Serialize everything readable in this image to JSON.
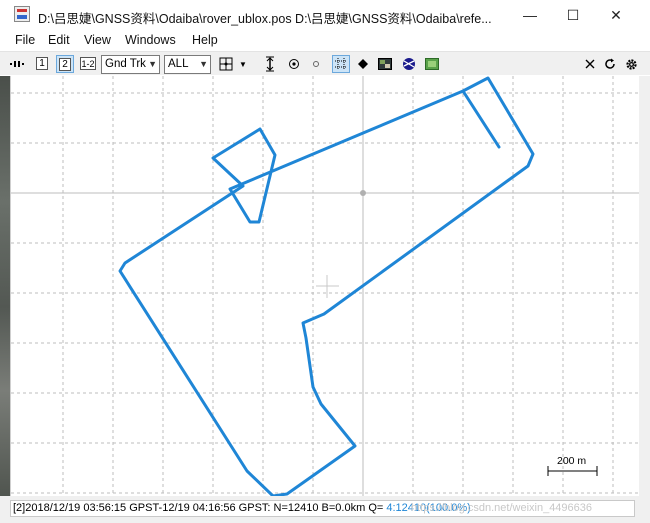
{
  "window": {
    "title": "D:\\吕思婕\\GNSS资料\\Odaiba\\rover_ublox.pos D:\\吕思婕\\GNSS资料\\Odaiba\\refe...",
    "minimize_glyph": "—",
    "maximize_glyph": "☐",
    "close_glyph": "✕"
  },
  "menu": [
    "File",
    "Edit",
    "View",
    "Windows",
    "Help"
  ],
  "toolbar": {
    "btn1": "1",
    "btn2": "2",
    "btn12": "1-2",
    "plot_type": "Gnd Trk",
    "quality": "ALL",
    "icons": [
      "show-stats-icon",
      "center-icon",
      "fit-vertical-icon",
      "origin-icon",
      "small-dot-icon",
      "grid-icon",
      "point-icon",
      "map-image-icon",
      "globe-icon",
      "layer-icon",
      "close-icon",
      "reload-icon",
      "gear-icon"
    ]
  },
  "map": {
    "scale_label": "200 m",
    "track_color": "#1f86d6",
    "grid_color": "#bdbdbd"
  },
  "status": {
    "prefix": "[2]",
    "time_range": "2018/12/19 03:56:15 GPST-12/19 04:16:56 GPST",
    "counts": ": N=12410 B=0.0km Q=",
    "q_value": "4:12410(100.0%)",
    "watermark": "https://blog.csdn.net/weixin_4496636"
  }
}
